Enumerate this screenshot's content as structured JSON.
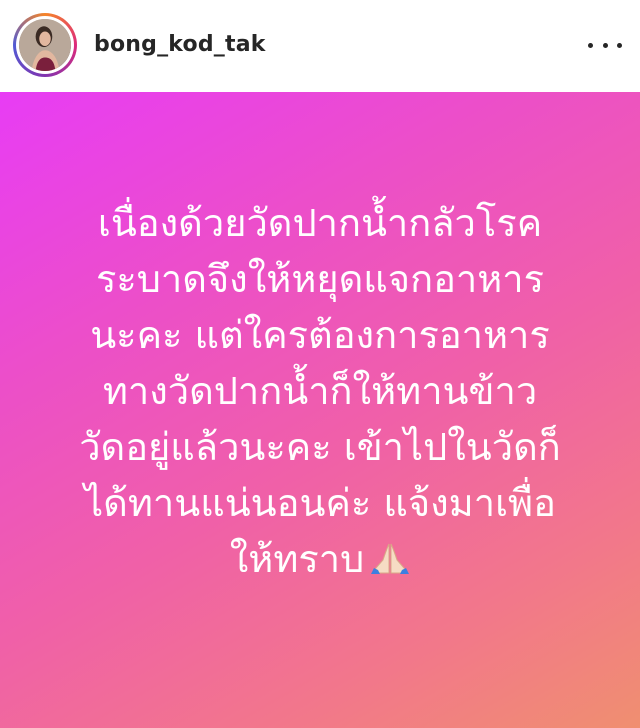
{
  "post": {
    "username": "bong_kod_tak",
    "more_icon": "more-horizontal-icon",
    "avatar_icon": "profile-photo",
    "caption_lines": [
      "เนื่องด้วยวัดปากน้ำกลัวโรค",
      "ระบาดจึงให้หยุดแจกอาหาร",
      "นะคะ แต่ใครต้องการอาหาร",
      "ทางวัดปากน้ำก็ให้ทานข้าว",
      "วัดอยู่แล้วนะคะ เข้าไปในวัดก็",
      "ได้ทานแน่นอนค่ะ แจ้งมาเพื่อ",
      "ให้ทราบ"
    ],
    "emoji": "folded-hands-emoji",
    "colors": {
      "gradient_start": "#e83cf5",
      "gradient_mid": "#f060a8",
      "gradient_end": "#f08f70",
      "text": "#ffffff",
      "username": "#262626"
    }
  }
}
